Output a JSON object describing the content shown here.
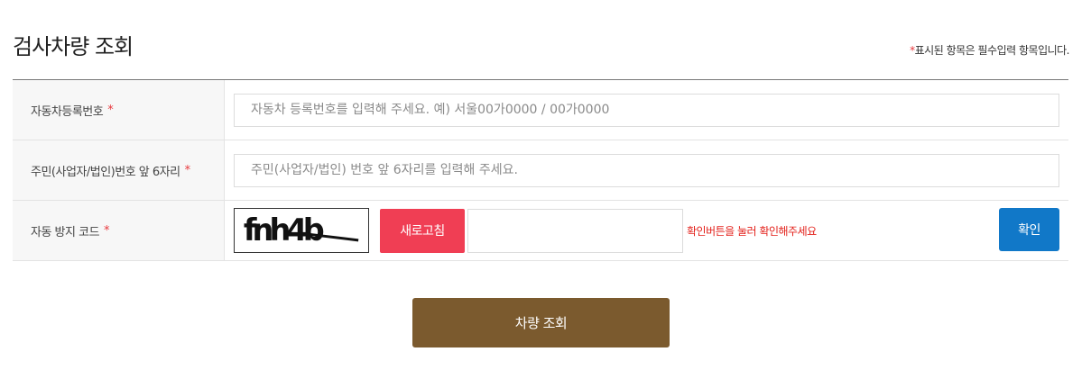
{
  "page": {
    "title": "검사차량 조회",
    "required_note": {
      "star": "*",
      "text": "표시된 항목은 필수입력 항목입니다."
    }
  },
  "form": {
    "rows": [
      {
        "label": "자동차등록번호",
        "star": "*",
        "placeholder": "자동차 등록번호를 입력해 주세요. 예) 서울00가0000 / 00가0000",
        "value": ""
      },
      {
        "label": "주민(사업자/법인)번호 앞 6자리",
        "star": "*",
        "placeholder": "주민(사업자/법인) 번호 앞 6자리를 입력해 주세요.",
        "value": ""
      },
      {
        "label": "자동 방지 코드",
        "star": "*",
        "captcha_text": "fnh4b",
        "refresh_label": "새로고침",
        "captcha_input_value": "",
        "hint": "확인버튼을 눌러 확인해주세요",
        "confirm_label": "확인"
      }
    ]
  },
  "submit_label": "차량 조회",
  "colors": {
    "required_star": "#e8383d",
    "refresh_button": "#f03e54",
    "hint_text": "#e3201a",
    "confirm_button": "#1178c8",
    "submit_button": "#7b5a2e"
  }
}
